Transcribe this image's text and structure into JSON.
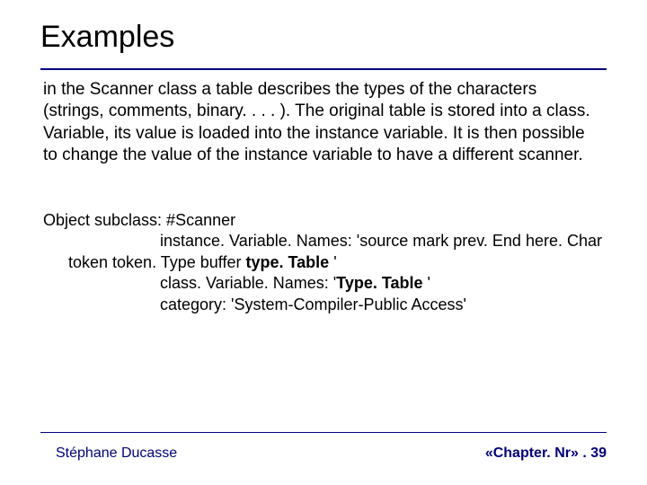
{
  "title": "Examples",
  "paragraph": "in the Scanner class a table describes the types of the characters (strings, comments, binary. . . . ). The original table is stored into a class. Variable, its value is loaded into the instance variable. It is then possible to change the value of the instance variable to have a different scanner.",
  "code": {
    "l1": "Object subclass: #Scanner",
    "l2": "instance. Variable. Names: 'source mark prev. End here. Char",
    "l3a": "token token. Type buffer ",
    "l3b": "type. Table ",
    "l3c": "'",
    "l4a": "class. Variable. Names: '",
    "l4b": "Type. Table ",
    "l4c": "'",
    "l5": "category: 'System-Compiler-Public Access'"
  },
  "footer": {
    "left": "Stéphane Ducasse",
    "right": "«Chapter. Nr» . 39"
  }
}
